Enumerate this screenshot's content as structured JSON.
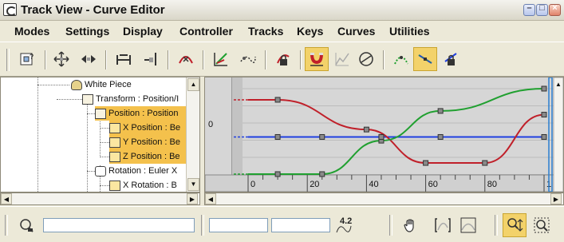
{
  "window": {
    "title": "Track View - Curve Editor",
    "minimize_label": "–",
    "maximize_label": "□",
    "close_label": "×"
  },
  "menu": [
    "Modes",
    "Settings",
    "Display",
    "Controller",
    "Tracks",
    "Keys",
    "Curves",
    "Utilities"
  ],
  "toolbar_icons": [
    "filters-icon",
    "move-keys-icon",
    "slide-keys-icon",
    "scale-keys-icon",
    "scale-values-icon",
    "add-keys-icon",
    "draw-curves-icon",
    "reduce-keys-icon",
    "lock-selection-icon",
    "snap-frames-icon",
    "parameter-curve-out-icon",
    "show-tangents-icon",
    "tangent-continuous-icon",
    "tangent-fast-icon",
    "lock-tangents-icon"
  ],
  "active_toolbar_icons": [
    "snap-frames-icon",
    "tangent-fast-icon"
  ],
  "tree": {
    "items": [
      {
        "label": "White Piece",
        "icon": "object-icon",
        "selected": false
      },
      {
        "label": "Transform : Position/I",
        "icon": "transform-icon",
        "selected": false
      },
      {
        "label": "Position : Position",
        "icon": "position-icon",
        "selected": true
      },
      {
        "label": "X Position : Be",
        "icon": "curve-icon",
        "selected": true
      },
      {
        "label": "Y Position : Be",
        "icon": "curve-icon",
        "selected": true
      },
      {
        "label": "Z Position : Be",
        "icon": "curve-icon",
        "selected": true
      },
      {
        "label": "Rotation : Euler X",
        "icon": "rotation-icon",
        "selected": false
      },
      {
        "label": "X Rotation : B",
        "icon": "curve-icon",
        "selected": false
      }
    ]
  },
  "curve_editor": {
    "y_axis_label": "0",
    "ruler_ticks": [
      "0",
      "20",
      "40",
      "60",
      "80",
      "1"
    ],
    "curve_colors": {
      "x": "#c0202a",
      "y": "#20a030",
      "z": "#2040e0"
    },
    "time_slider_color": "#2a7fd0",
    "x_curve": [
      [
        0,
        100
      ],
      [
        10,
        100
      ],
      [
        40,
        60
      ],
      [
        60,
        15
      ],
      [
        80,
        15
      ],
      [
        100,
        80
      ]
    ],
    "y_curve": [
      [
        0,
        0
      ],
      [
        10,
        0
      ],
      [
        25,
        0
      ],
      [
        45,
        45
      ],
      [
        65,
        85
      ],
      [
        100,
        115
      ]
    ],
    "z_curve": [
      [
        0,
        50
      ],
      [
        10,
        50
      ],
      [
        25,
        50
      ],
      [
        45,
        50
      ],
      [
        65,
        50
      ],
      [
        100,
        50
      ]
    ],
    "keys": [
      {
        "curve": "x",
        "frames": [
          10,
          40,
          60,
          80,
          100
        ]
      },
      {
        "curve": "y",
        "frames": [
          10,
          25,
          45,
          65,
          100
        ]
      },
      {
        "curve": "z",
        "frames": [
          10,
          25,
          45,
          65,
          100
        ]
      }
    ]
  },
  "status": {
    "frame_readout": "4.2",
    "icons": [
      "key-mode-icon",
      "pan-icon",
      "frame-horizontal-icon",
      "frame-values-icon",
      "zoom-icon",
      "zoom-region-icon"
    ],
    "active_icon": "zoom-icon"
  }
}
